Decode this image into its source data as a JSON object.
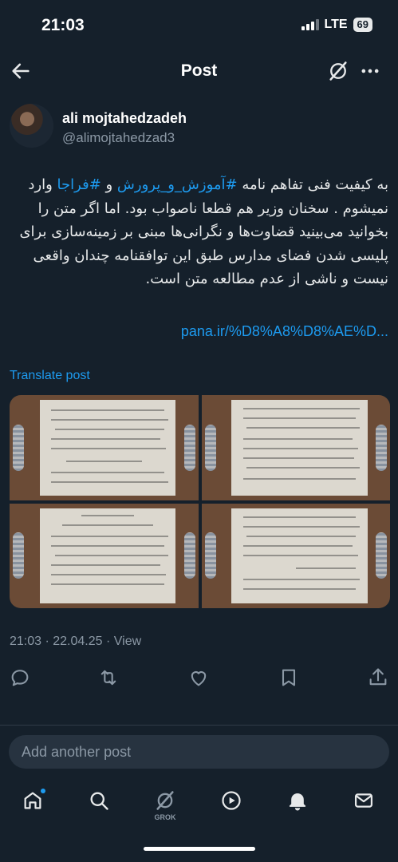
{
  "status_bar": {
    "time": "21:03",
    "network": "LTE",
    "battery": "69"
  },
  "header": {
    "title": "Post"
  },
  "author": {
    "name": "ali mojtahedzadeh",
    "handle": "@alimojtahedzad3"
  },
  "post": {
    "text_intro": "به کیفیت فنی تفاهم نامه ",
    "hashtag_1": "#آموزش_و_پرورش",
    "text_and": " و ",
    "hashtag_2": "#فراجا",
    "text_body": " وارد نمیشوم . سخنان وزیر هم قطعا ناصواب بود. اما اگر متن را بخوانید می‌بینید قضاوت‌ها و نگرانی‌ها مبنی بر زمینه‌سازی برای پلیسی شدن فضای مدارس طبق این توافقنامه چندان واقعی نیست و ناشی از عدم مطالعه متن است.",
    "link": "pana.ir/%D8%A8%D8%AE%D...",
    "translate_label": "Translate post",
    "timestamp": "21:03 · 22.04.25 · View"
  },
  "media": {
    "image_count": 4
  },
  "actions": {
    "icons": [
      "reply-icon",
      "repost-icon",
      "like-icon",
      "bookmark-icon",
      "share-icon"
    ]
  },
  "reply": {
    "placeholder": "Add another post"
  },
  "bottom_nav": {
    "grok_label": "GROK",
    "icons": [
      "home-icon",
      "search-icon",
      "grok-icon",
      "video-icon",
      "notifications-icon",
      "messages-icon"
    ]
  },
  "colors": {
    "background": "#15202b",
    "accent": "#1d9bf0",
    "muted_text": "#8b98a5"
  }
}
